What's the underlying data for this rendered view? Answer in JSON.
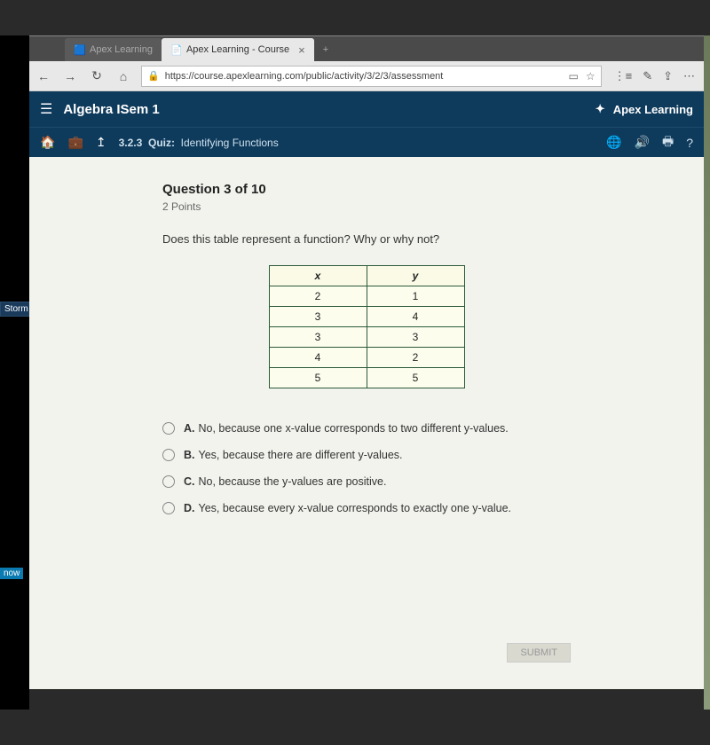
{
  "tabs": {
    "inactive_label": "Apex Learning",
    "active_label": "Apex Learning - Course"
  },
  "addressbar": {
    "url": "https://course.apexlearning.com/public/activity/3/2/3/assessment"
  },
  "header": {
    "course": "Algebra ISem 1",
    "brand": "Apex Learning"
  },
  "subheader": {
    "crumb": "3.2.3",
    "quiz_label": "Quiz:",
    "quiz_title": "Identifying Functions"
  },
  "question": {
    "title": "Question 3 of 10",
    "points": "2 Points",
    "prompt": "Does this table represent a function? Why or why not?"
  },
  "chart_data": {
    "type": "table",
    "columns": [
      "x",
      "y"
    ],
    "rows": [
      [
        "2",
        "1"
      ],
      [
        "3",
        "4"
      ],
      [
        "3",
        "3"
      ],
      [
        "4",
        "2"
      ],
      [
        "5",
        "5"
      ]
    ]
  },
  "choices": [
    {
      "letter": "A.",
      "text": "No, because one x-value corresponds to two different y-values."
    },
    {
      "letter": "B.",
      "text": "Yes, because there are different y-values."
    },
    {
      "letter": "C.",
      "text": "No, because the y-values are positive."
    },
    {
      "letter": "D.",
      "text": "Yes, because every x-value corresponds to exactly one y-value."
    }
  ],
  "buttons": {
    "submit": "SUBMIT"
  },
  "sidebar": {
    "badge": "Storm",
    "now": "now"
  }
}
